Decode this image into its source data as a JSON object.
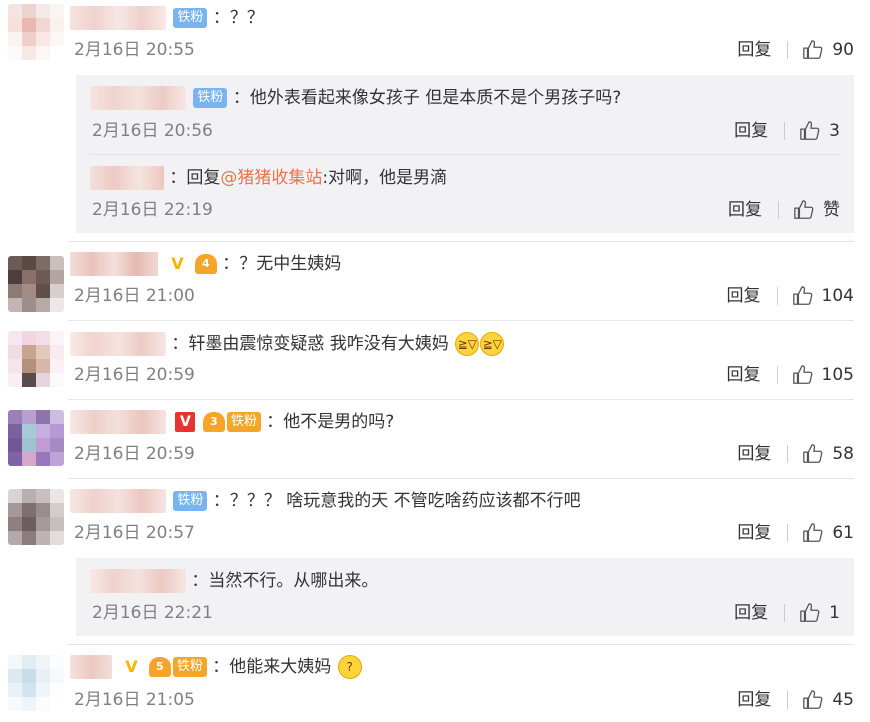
{
  "ui": {
    "reply_label": "回复",
    "colon": "：",
    "badge_fan": "铁粉",
    "verified_mark": "V"
  },
  "comments": [
    {
      "text": "？？",
      "time": "2月16日 20:55",
      "likes": "90",
      "replies": [
        {
          "text": "他外表看起来像女孩子 但是本质不是个男孩子吗?",
          "time": "2月16日 20:56",
          "likes": "3"
        },
        {
          "reply_prefix": "回复",
          "mention": "@猪猪收集站",
          "text": ":对啊，他是男滴",
          "time": "2月16日 22:19",
          "likes": "赞"
        }
      ]
    },
    {
      "text": "？无中生姨妈",
      "time": "2月16日 21:00",
      "likes": "104",
      "level": "4"
    },
    {
      "text": "轩墨由震惊变疑惑 我咋没有大姨妈",
      "time": "2月16日 20:59",
      "likes": "105",
      "emojis": [
        "laugh-cry-emoji",
        "laugh-cry-emoji"
      ]
    },
    {
      "text": "他不是男的吗?",
      "time": "2月16日 20:59",
      "likes": "58",
      "level": "3"
    },
    {
      "text": "？？？ 啥玩意我的天 不管吃啥药应该都不行吧",
      "time": "2月16日 20:57",
      "likes": "61",
      "replies": [
        {
          "text": "当然不行。从哪出来。",
          "time": "2月16日 22:21",
          "likes": "1"
        }
      ]
    },
    {
      "text": "他能来大姨妈",
      "time": "2月16日 21:05",
      "likes": "45",
      "level": "5",
      "emojis": [
        "puzzled-emoji"
      ]
    }
  ],
  "colors": {
    "mention": "#eb7350",
    "badge_fan": "#78b3f2",
    "badge_gold": "#f4a52a",
    "verified_yellow": "#f7b500",
    "verified_red": "#e6352e",
    "subreply_bg": "#f2f2f5",
    "meta_gray": "#808080"
  }
}
